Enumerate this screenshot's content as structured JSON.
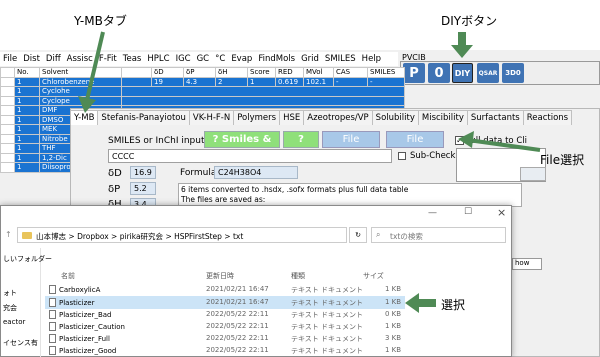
{
  "annotations": {
    "ymb_tab": "Y-MBタブ",
    "diy_button": "DIYボタン",
    "file_select": "File選択",
    "select": "選択"
  },
  "menu": [
    "File",
    "Dist",
    "Diff",
    "Assisc",
    "F-Fit",
    "Teas",
    "HPLC",
    "IGC",
    "GC",
    "°C",
    "Evap",
    "FindMols",
    "Grid",
    "SMILES",
    "Help"
  ],
  "pvcib": "PVCIB",
  "toolbar": {
    "p": "P",
    "o": "0",
    "diy": "DIY",
    "qsar": "QSAR",
    "three_d": "3D0"
  },
  "grid": {
    "headers": [
      "No.",
      "Solvent",
      "",
      "δD",
      "δP",
      "δH",
      "Score",
      "RED",
      "MVol",
      "CAS",
      "SMILES"
    ],
    "rows": [
      [
        "1",
        "Chlorobenzene",
        "",
        "19",
        "4.3",
        "2",
        "1",
        "0.619",
        "102.1",
        "-",
        "-"
      ],
      [
        "1",
        "Cyclohe",
        "",
        "",
        "",
        "",
        "",
        "",
        "",
        "",
        ""
      ],
      [
        "1",
        "Cyclope",
        "",
        "",
        "",
        "",
        "",
        "",
        "",
        "",
        ""
      ],
      [
        "1",
        "DMF",
        "",
        "",
        "",
        "",
        "",
        "",
        "",
        "",
        ""
      ],
      [
        "1",
        "DMSO",
        "",
        "",
        "",
        "",
        "",
        "",
        "",
        "",
        ""
      ],
      [
        "1",
        "MEK",
        "",
        "",
        "",
        "",
        "",
        "",
        "",
        "",
        ""
      ],
      [
        "1",
        "Nitrobe",
        "",
        "",
        "",
        "",
        "",
        "",
        "",
        "",
        ""
      ],
      [
        "1",
        "THF",
        "",
        "",
        "",
        "",
        "",
        "",
        "",
        "",
        ""
      ],
      [
        "1",
        "1,2-Dic",
        "",
        "",
        "",
        "",
        "",
        "",
        "",
        "",
        ""
      ],
      [
        "1",
        "Diisopro",
        "",
        "",
        "",
        "",
        "",
        "",
        "",
        "",
        ""
      ]
    ]
  },
  "tabs": [
    "Y-MB",
    "Stefanis-Panayiotou",
    "VK-H-F-N",
    "Polymers",
    "HSE",
    "Azeotropes/VP",
    "Solubility",
    "Miscibility",
    "Surfactants",
    "Reactions"
  ],
  "ymb": {
    "input_label": "SMILES or InChI input",
    "smiles_btn": "? Smiles &",
    "q_btn": "?",
    "file_btn1": "File",
    "file_btn2": "File",
    "full_data_label": "Full data to Cli",
    "sub_check_label": "Sub-Check",
    "smiles_value": "CCCC",
    "formula_label": "Formula",
    "formula_value": "C24H38O4",
    "dD_label": "δD",
    "dD_value": "16.9",
    "dP_label": "δP",
    "dP_value": "5.2",
    "dH_label": "δH",
    "dH_value": "3.4",
    "message_line1": "6 items converted to .hsdx, .sofx formats plus full data table",
    "message_line2": "The files are saved as:"
  },
  "explorer": {
    "breadcrumb": [
      "山本博志",
      "Dropbox",
      "pirika研究会",
      "HSPFirstStep",
      "txt"
    ],
    "search_placeholder": "txtの検索",
    "columns": [
      "名前",
      "更新日時",
      "種類",
      "サイズ"
    ],
    "sidebar": [
      "しいフォルダー",
      "ォト",
      "究会",
      "eactor",
      "イセンス有"
    ],
    "files": [
      {
        "name": "CarboxylicA",
        "date": "2021/02/21 16:47",
        "type": "テキスト ドキュメント",
        "size": "1 KB"
      },
      {
        "name": "Plasticizer",
        "date": "2021/02/21 16:47",
        "type": "テキスト ドキュメント",
        "size": "1 KB"
      },
      {
        "name": "Plasticizer_Bad",
        "date": "2022/05/22 22:11",
        "type": "テキスト ドキュメント",
        "size": "0 KB"
      },
      {
        "name": "Plasticizer_Caution",
        "date": "2022/05/22 22:11",
        "type": "テキスト ドキュメント",
        "size": "1 KB"
      },
      {
        "name": "Plasticizer_Full",
        "date": "2022/05/22 22:11",
        "type": "テキスト ドキュメント",
        "size": "3 KB"
      },
      {
        "name": "Plasticizer_Good",
        "date": "2022/05/22 22:11",
        "type": "テキスト ドキュメント",
        "size": "1 KB"
      }
    ],
    "side_partial": "how"
  },
  "colors": {
    "arrow": "#4f8a55",
    "selected": "#1a73d1",
    "green_button": "#8fe07a",
    "blue_button": "#a8c8e8"
  }
}
